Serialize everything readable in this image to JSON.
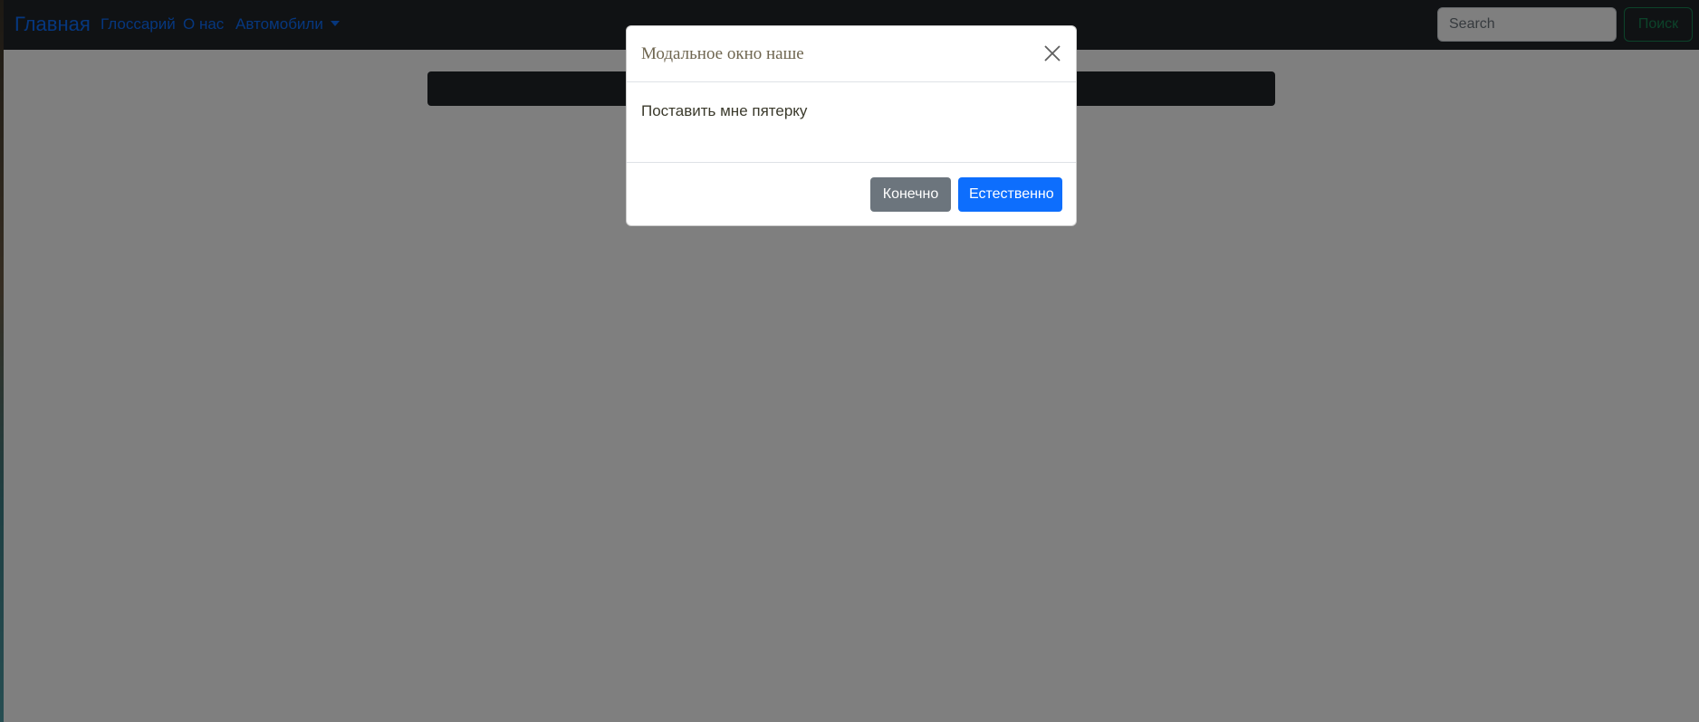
{
  "navbar": {
    "brand": "Главная",
    "links": [
      "Глоссарий",
      "О нас",
      "Автомобили"
    ],
    "search_placeholder": "Search",
    "search_button": "Поиск"
  },
  "modal": {
    "title": "Модальное окно наше",
    "body": "Поставить мне пятерку",
    "buttons": {
      "secondary": "Конечно",
      "primary": "Естественно"
    }
  },
  "colors": {
    "navbar_bg": "#212529",
    "link": "#0d6efd",
    "success": "#198754",
    "secondary": "#6c757d",
    "primary": "#0d6efd"
  },
  "icons": {
    "close": "close-icon",
    "dropdown": "chevron-down-icon"
  }
}
